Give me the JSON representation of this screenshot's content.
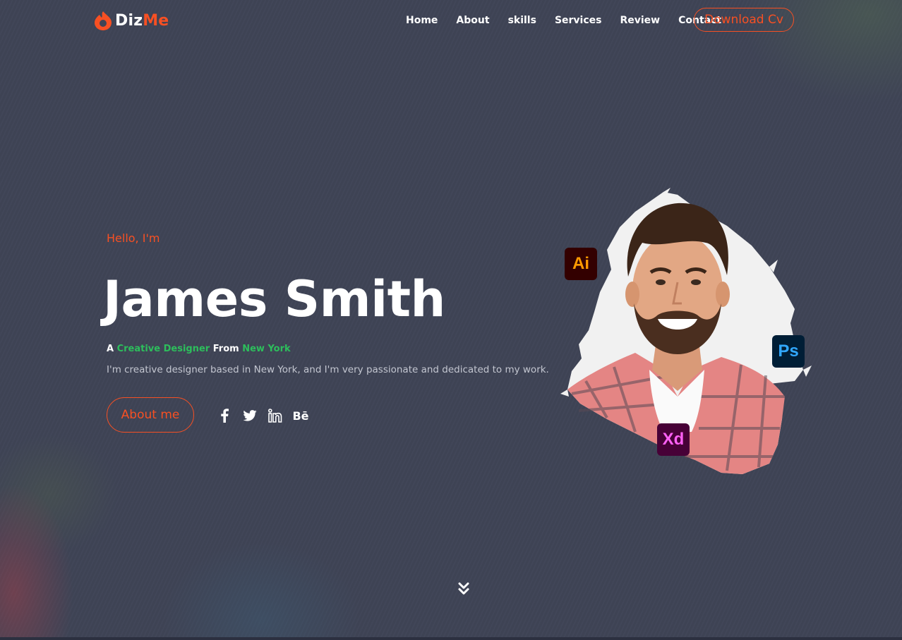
{
  "brand": {
    "name_part1": "Diz",
    "name_part2": "Me",
    "accent_color": "#f75023",
    "logo_icon": "flame-icon"
  },
  "nav": {
    "items": [
      {
        "label": "Home"
      },
      {
        "label": "About"
      },
      {
        "label": "skills"
      },
      {
        "label": "Services"
      },
      {
        "label": "Review"
      },
      {
        "label": "Contact"
      }
    ],
    "cta_label": "Download Cv"
  },
  "hero": {
    "greeting": "Hello, I'm",
    "name": "James Smith",
    "tagline": {
      "prefix": "A",
      "role": "Creative Designer",
      "middle": "From",
      "location": "New York"
    },
    "description": "I'm creative designer based in New York, and I'm very passionate and dedicated to my work.",
    "about_button": "About me",
    "highlight_color": "#2dbe5c",
    "socials": [
      {
        "icon": "facebook-icon"
      },
      {
        "icon": "twitter-icon"
      },
      {
        "icon": "linkedin-icon"
      },
      {
        "icon": "behance-icon",
        "text": "Bē"
      }
    ]
  },
  "portrait": {
    "badges": [
      {
        "text": "Ai",
        "icon": "illustrator-icon"
      },
      {
        "text": "Ps",
        "icon": "photoshop-icon"
      },
      {
        "text": "Xd",
        "icon": "xd-icon"
      }
    ]
  },
  "scroll_icon": "double-chevron-down-icon"
}
